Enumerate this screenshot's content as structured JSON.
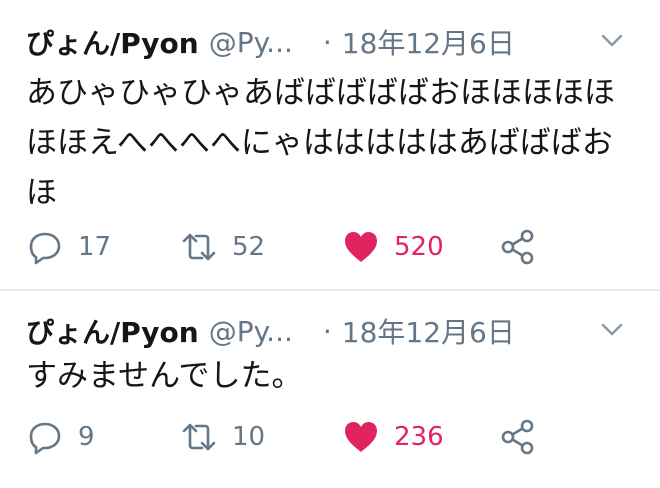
{
  "colors": {
    "like": "#e0245e",
    "muted": "#657786",
    "text": "#14171a"
  },
  "tweets": [
    {
      "name": "ぴょん/Pyon",
      "handle": "@Py...",
      "separator": "·",
      "date": "18年12月6日",
      "text": "あひゃひゃひゃあばばばばばおほほほほほほほえへへへへにゃはははははあばばばおほ",
      "reply_count": "17",
      "retweet_count": "52",
      "like_count": "520",
      "icons": [
        "reply-icon",
        "retweet-icon",
        "heart-icon",
        "share-icon",
        "chevron-down-icon"
      ]
    },
    {
      "name": "ぴょん/Pyon",
      "handle": "@Py...",
      "separator": "·",
      "date": "18年12月6日",
      "text": "すみませんでした。",
      "reply_count": "9",
      "retweet_count": "10",
      "like_count": "236",
      "icons": [
        "reply-icon",
        "retweet-icon",
        "heart-icon",
        "share-icon",
        "chevron-down-icon"
      ]
    }
  ]
}
